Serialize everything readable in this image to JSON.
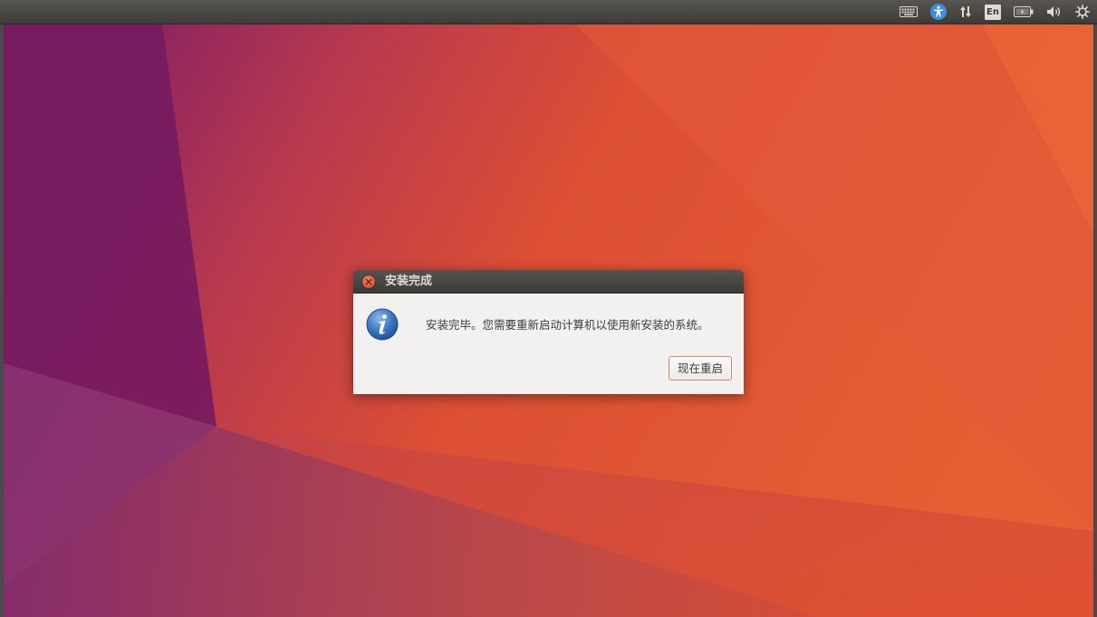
{
  "top_panel": {
    "indicators": [
      {
        "name": "keyboard-icon"
      },
      {
        "name": "accessibility-icon"
      },
      {
        "name": "network-icon"
      },
      {
        "name": "input-method-indicator",
        "label": "En"
      },
      {
        "name": "battery-icon"
      },
      {
        "name": "volume-icon"
      },
      {
        "name": "settings-gear-icon"
      }
    ]
  },
  "dialog": {
    "title": "安装完成",
    "message": "安装完毕。您需要重新启动计算机以使用新安装的系统。",
    "restart_button_label": "现在重启",
    "icon": "info-icon",
    "close_icon": "close-icon"
  },
  "colors": {
    "panel": "#3c3b37",
    "dialog_body": "#f2f1f0",
    "accent": "#e95420",
    "wallpaper_purple": "#7a1d62",
    "wallpaper_orange": "#e05a30"
  }
}
